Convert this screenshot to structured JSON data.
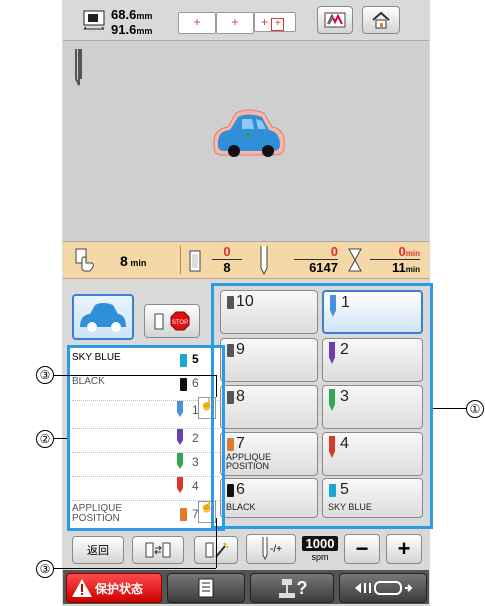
{
  "header": {
    "width_value": "68.6",
    "width_unit": "mm",
    "height_value": "91.6",
    "height_unit": "mm"
  },
  "time_bar": {
    "remaining_time": "8",
    "remaining_unit": "min",
    "color_current": "0",
    "color_total": "8",
    "stitch_current": "0",
    "stitch_total": "6147",
    "time_current": "0",
    "time_total": "11",
    "time_unit": "min"
  },
  "thread_list": [
    {
      "label": "SKY BLUE",
      "number": "5",
      "color": "#1aa7d8"
    },
    {
      "label": "BLACK",
      "number": "6",
      "color": "#111111"
    },
    {
      "label": "",
      "number": "1",
      "color": "#4a90e2"
    },
    {
      "label": "",
      "number": "2",
      "color": "#6a3fb0"
    },
    {
      "label": "",
      "number": "3",
      "color": "#2fa84f"
    },
    {
      "label": "",
      "number": "4",
      "color": "#d83a2a"
    },
    {
      "label": "APPLIQUE POSITION",
      "number": "7",
      "color": "#e07a2c"
    }
  ],
  "needle_grid": [
    {
      "number": "10",
      "name": "",
      "color": "#555555",
      "selected": false
    },
    {
      "number": "1",
      "name": "",
      "color": "#4a90e2",
      "selected": true
    },
    {
      "number": "9",
      "name": "",
      "color": "#555555",
      "selected": false
    },
    {
      "number": "2",
      "name": "",
      "color": "#6a3fb0",
      "selected": false
    },
    {
      "number": "8",
      "name": "",
      "color": "#555555",
      "selected": false
    },
    {
      "number": "3",
      "name": "",
      "color": "#2fa84f",
      "selected": false
    },
    {
      "number": "7",
      "name": "APPLIQUE POSITION",
      "color": "#e07a2c",
      "selected": false
    },
    {
      "number": "4",
      "name": "",
      "color": "#d83a2a",
      "selected": false
    },
    {
      "number": "6",
      "name": "BLACK",
      "color": "#111111",
      "selected": false
    },
    {
      "number": "5",
      "name": "SKY BLUE",
      "color": "#1aa7d8",
      "selected": false
    }
  ],
  "controls": {
    "back_label": "返回",
    "speed_value": "1000",
    "speed_unit": "spm",
    "minus_label": "−",
    "plus_label": "+",
    "needle_step_label": "-/+"
  },
  "footer": {
    "lock_label": "保护状态",
    "help_label": "?"
  },
  "callouts": {
    "c1": "①",
    "c2": "②",
    "c3a": "③",
    "c3b": "③"
  },
  "colors": {
    "accent": "#2b9be6",
    "lock_red": "#e02020",
    "car_blue": "#2f8fd8"
  }
}
